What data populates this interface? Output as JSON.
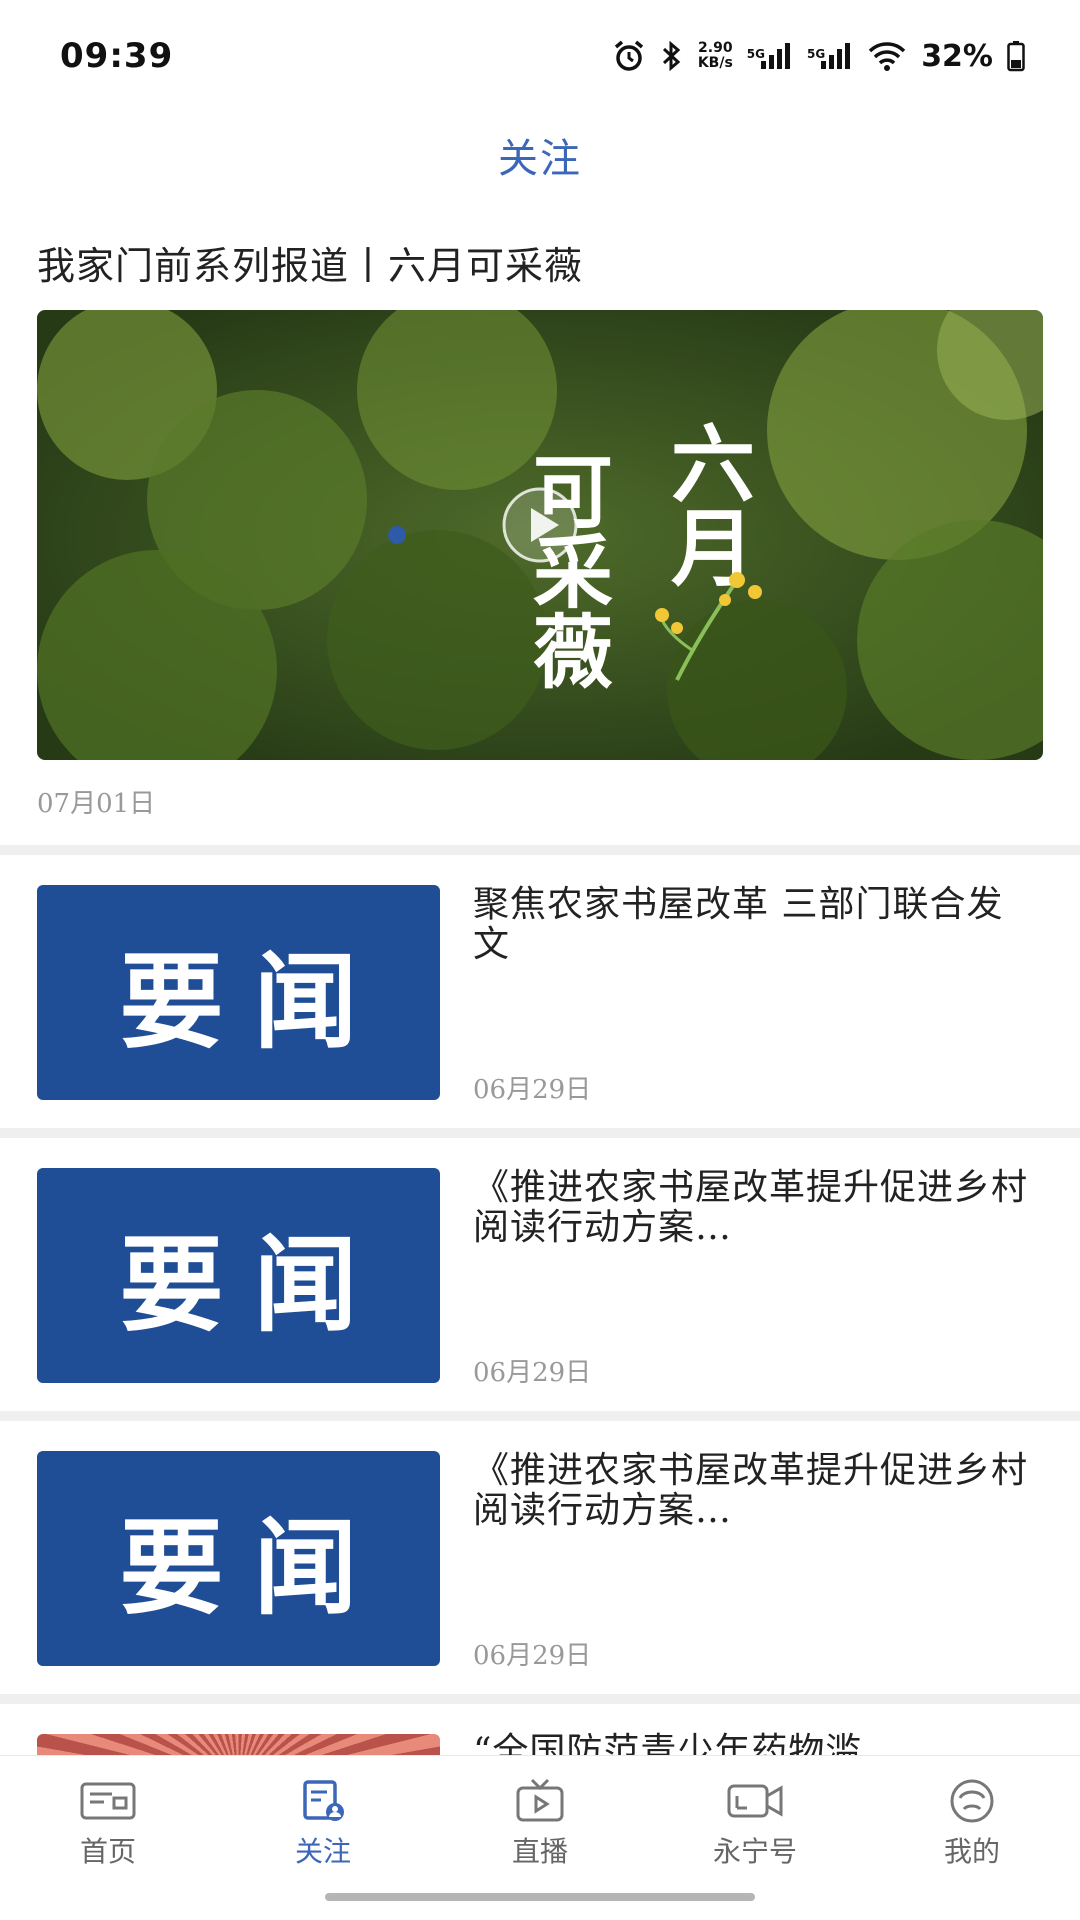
{
  "status_bar": {
    "time": "09:39",
    "net_speed_value": "2.90",
    "net_speed_unit": "KB/s",
    "signal_1_label": "5G",
    "signal_2_label": "5G",
    "battery": "32%",
    "icons": [
      "alarm-icon",
      "bluetooth-icon",
      "signal-icon",
      "signal-icon",
      "wifi-icon",
      "battery-icon"
    ]
  },
  "header": {
    "title": "关注"
  },
  "featured": {
    "title": "我家门前系列报道丨六月可采薇",
    "image_text_right": "六月",
    "image_text_left": "可采薇",
    "date": "07月01日"
  },
  "news_items": [
    {
      "thumb_text": "要闻",
      "title": "聚焦农家书屋改革  三部门联合发文",
      "date": "06月29日"
    },
    {
      "thumb_text": "要闻",
      "title": "《推进农家书屋改革提升促进乡村阅读行动方案…",
      "date": "06月29日"
    },
    {
      "thumb_text": "要闻",
      "title": "《推进农家书屋改革提升促进乡村阅读行动方案…",
      "date": "06月29日"
    },
    {
      "thumb_text": "",
      "title": "“全国防范青少年药物滥",
      "date": ""
    }
  ],
  "tabs": [
    {
      "label": "首页",
      "icon": "news-icon",
      "active": false
    },
    {
      "label": "关注",
      "icon": "follow-icon",
      "active": true
    },
    {
      "label": "直播",
      "icon": "tv-icon",
      "active": false
    },
    {
      "label": "永宁号",
      "icon": "video-camera-icon",
      "active": false
    },
    {
      "label": "我的",
      "icon": "profile-icon",
      "active": false
    }
  ],
  "colors": {
    "accent": "#3c67b9",
    "thumb_bg": "#1f4e96"
  }
}
